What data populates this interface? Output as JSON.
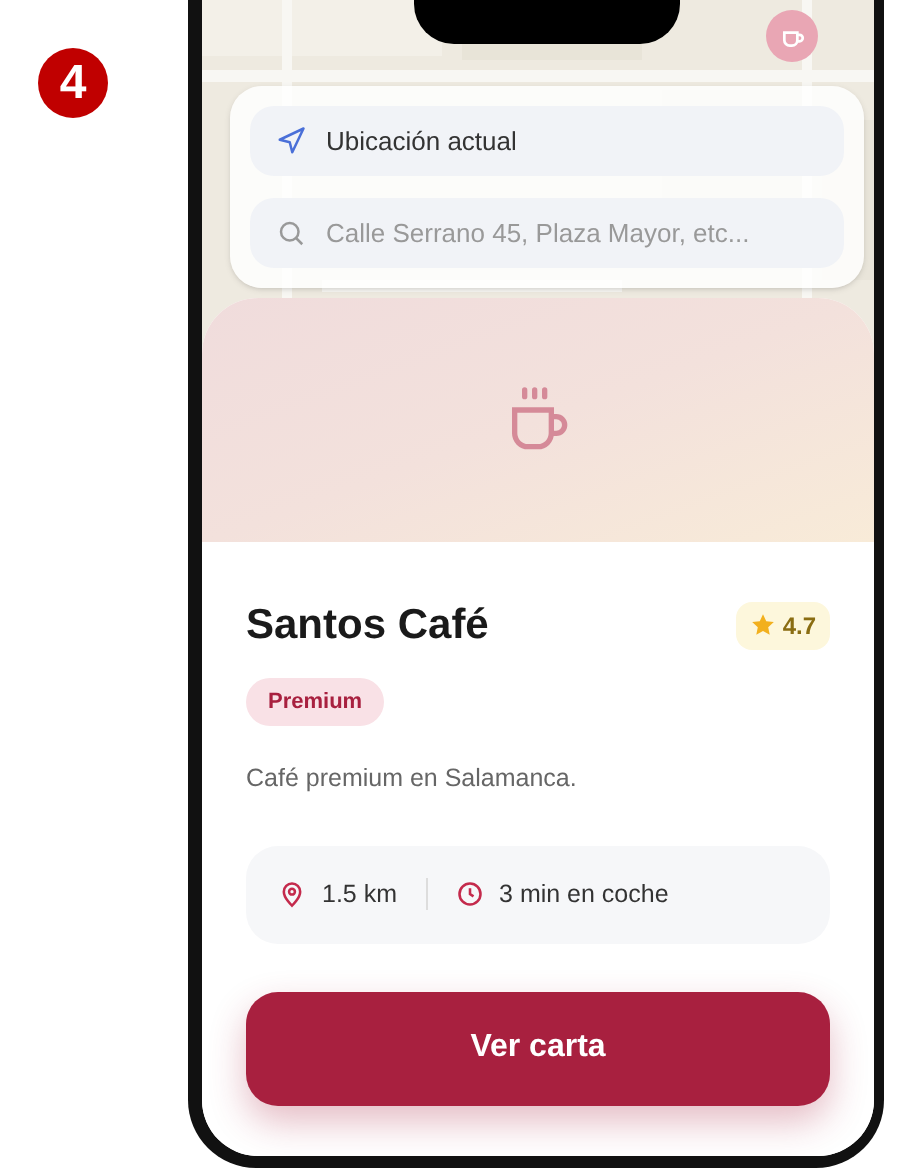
{
  "step_badge": "4",
  "search_panel": {
    "current_location": {
      "label": "Ubicación actual"
    },
    "search": {
      "placeholder": "Calle Serrano 45, Plaza Mayor, etc..."
    }
  },
  "place": {
    "name": "Santos Café",
    "rating": "4.7",
    "tag": "Premium",
    "description": "Café premium en Salamanca.",
    "distance": "1.5 km",
    "travel_time": "3 min en coche"
  },
  "primary_button": "Ver carta"
}
